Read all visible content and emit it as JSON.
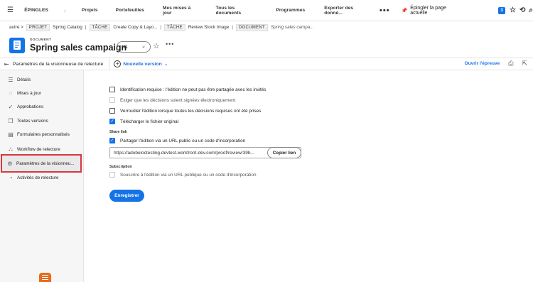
{
  "topnav": {
    "items": [
      "ÉPINGLES",
      "Projets",
      "Portefeuilles",
      "Mes mises à jour",
      "Tous les documents",
      "Programmes",
      "Exporter des donné..."
    ],
    "more": "•••",
    "pin_label": "Épingler la page actuelle",
    "badge_count": "3"
  },
  "breadcrumb": {
    "root": "autre >",
    "tag1": "PROJET",
    "project": "Spring Catalog",
    "tag2": "TÂCHE",
    "task1": "Create Copy & Layo...",
    "tag3": "TÂCHE",
    "task2": "Review Stock Image",
    "tag4": "DOCUMENT",
    "current": "Spring sales campa..."
  },
  "document": {
    "type_label": "DOCUMENT",
    "title": "Spring sales campaign",
    "version": "v1"
  },
  "toolbar": {
    "title": "Paramètres de la visionneuse de relecture",
    "new_version": "Nouvelle version",
    "open_proof": "Ouvrir l'épreuve"
  },
  "sidebar": {
    "items": [
      {
        "label": "Détails",
        "icon": "details-icon"
      },
      {
        "label": "Mises à jour",
        "icon": "updates-icon"
      },
      {
        "label": "Approbations",
        "icon": "approvals-icon"
      },
      {
        "label": "Toutes versions",
        "icon": "versions-icon"
      },
      {
        "label": "Formulaires personnalisés",
        "icon": "custom-forms-icon"
      },
      {
        "label": "Workflow de relecture",
        "icon": "workflow-icon"
      },
      {
        "label": "Paramètres de la visionneu...",
        "icon": "gear-icon"
      },
      {
        "label": "Activités de relecture",
        "icon": "activity-icon"
      }
    ]
  },
  "settings": {
    "options": [
      {
        "label": "Identification requise : l'édition ne peut pas être partagée avec les invités",
        "checked": false
      },
      {
        "label": "Exiger que les décisions soient signées électroniquement",
        "checked": false,
        "disabled": true
      },
      {
        "label": "Verrouiller l'édition lorsque toutes les décisions requises ont été prises",
        "checked": false
      },
      {
        "label": "Télécharger le fichier original",
        "checked": true
      }
    ],
    "share_heading": "Share link",
    "share_option": "Partager l'édition via un URL public ou un code d'incorporation",
    "share_url": "https://adobeloctesting.devtest.workfront-dev.com/proof/review/39b...",
    "copy_label": "Copier lien",
    "subscription_heading": "Subscription",
    "subscription_option": "Souscrire à l'édition via un URL publique ou un code d'incorporation",
    "save_label": "Enregistrer"
  }
}
